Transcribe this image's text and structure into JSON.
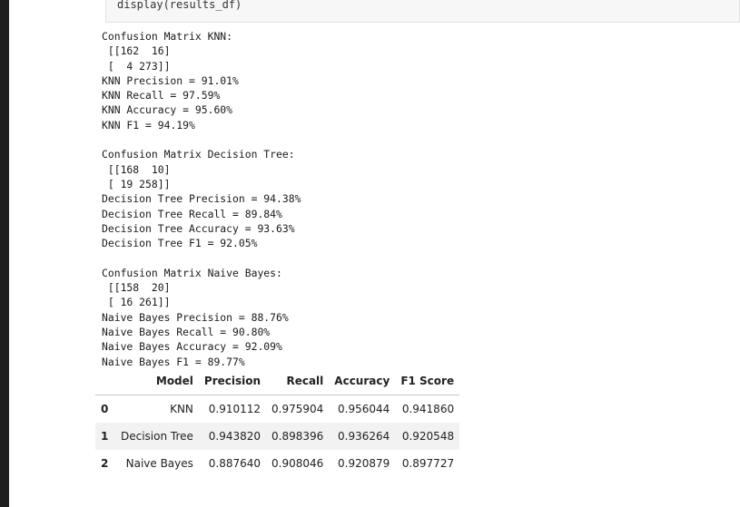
{
  "code_cell": {
    "line": "display(results_df)"
  },
  "output_lines": [
    "Confusion Matrix KNN:",
    " [[162  16]",
    " [  4 273]]",
    "KNN Precision = 91.01%",
    "KNN Recall = 97.59%",
    "KNN Accuracy = 95.60%",
    "KNN F1 = 94.19%",
    "",
    "Confusion Matrix Decision Tree:",
    " [[168  10]",
    " [ 19 258]]",
    "Decision Tree Precision = 94.38%",
    "Decision Tree Recall = 89.84%",
    "Decision Tree Accuracy = 93.63%",
    "Decision Tree F1 = 92.05%",
    "",
    "Confusion Matrix Naive Bayes:",
    " [[158  20]",
    " [ 16 261]]",
    "Naive Bayes Precision = 88.76%",
    "Naive Bayes Recall = 90.80%",
    "Naive Bayes Accuracy = 92.09%",
    "Naive Bayes F1 = 89.77%"
  ],
  "results_table": {
    "columns": [
      "",
      "Model",
      "Precision",
      "Recall",
      "Accuracy",
      "F1 Score"
    ],
    "rows": [
      [
        "0",
        "KNN",
        "0.910112",
        "0.975904",
        "0.956044",
        "0.941860"
      ],
      [
        "1",
        "Decision Tree",
        "0.943820",
        "0.898396",
        "0.936264",
        "0.920548"
      ],
      [
        "2",
        "Naive Bayes",
        "0.887640",
        "0.908046",
        "0.920879",
        "0.897727"
      ]
    ]
  }
}
